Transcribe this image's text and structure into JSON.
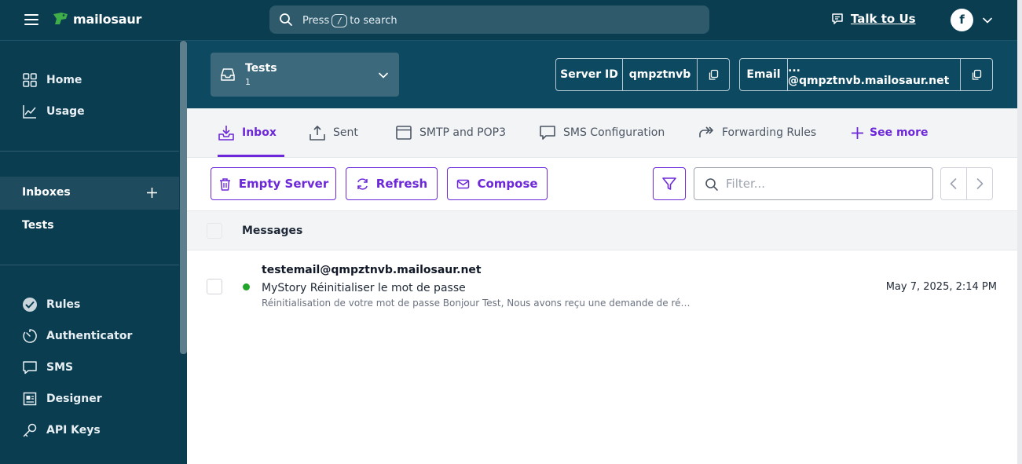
{
  "topbar": {
    "brand": "mailosaur",
    "search_prefix": "Press",
    "search_key": "/",
    "search_suffix": "to search",
    "talk_label": "Talk to Us",
    "avatar_initial": "f"
  },
  "sidebar": {
    "items_top": [
      {
        "label": "Home",
        "icon": "grid-icon"
      },
      {
        "label": "Usage",
        "icon": "chart-line-icon"
      }
    ],
    "inboxes_label": "Inboxes",
    "inboxes": [
      {
        "label": "Tests"
      }
    ],
    "items_bottom": [
      {
        "label": "Rules",
        "icon": "check-circle-icon"
      },
      {
        "label": "Authenticator",
        "icon": "timer-icon"
      },
      {
        "label": "SMS",
        "icon": "chat-icon"
      },
      {
        "label": "Designer",
        "icon": "designer-icon"
      },
      {
        "label": "API Keys",
        "icon": "key-icon"
      }
    ]
  },
  "server": {
    "name": "Tests",
    "count": "1",
    "server_id_label": "Server ID",
    "server_id": "qmpztnvb",
    "email_label": "Email",
    "email_value": "... @qmpztnvb.mailosaur.net"
  },
  "tabs": [
    {
      "label": "Inbox",
      "icon": "inbox-download-icon",
      "active": true
    },
    {
      "label": "Sent",
      "icon": "upload-icon",
      "active": false
    },
    {
      "label": "SMTP and POP3",
      "icon": "window-icon",
      "active": false
    },
    {
      "label": "SMS Configuration",
      "icon": "chat-icon",
      "active": false
    },
    {
      "label": "Forwarding Rules",
      "icon": "forward-icon",
      "active": false
    }
  ],
  "see_more_label": "See more",
  "toolbar": {
    "empty_label": "Empty Server",
    "refresh_label": "Refresh",
    "compose_label": "Compose",
    "filter_placeholder": "Filter...",
    "filter_value": ""
  },
  "table": {
    "header": "Messages",
    "rows": [
      {
        "from": "testemail@qmpztnvb.mailosaur.net",
        "subject": "MyStory Réinitialiser le mot de passe",
        "preview": "Réinitialisation de votre mot de passe Bonjour Test, Nous avons reçu une demande de ré…",
        "date": "May 7, 2025, 2:14 PM",
        "unread": true
      }
    ]
  },
  "colors": {
    "navy": "#0b3d51",
    "header_band": "#0d4a62",
    "accent": "#6d28d9",
    "unread_dot": "#22a52b",
    "logo_green": "#3fae49"
  }
}
